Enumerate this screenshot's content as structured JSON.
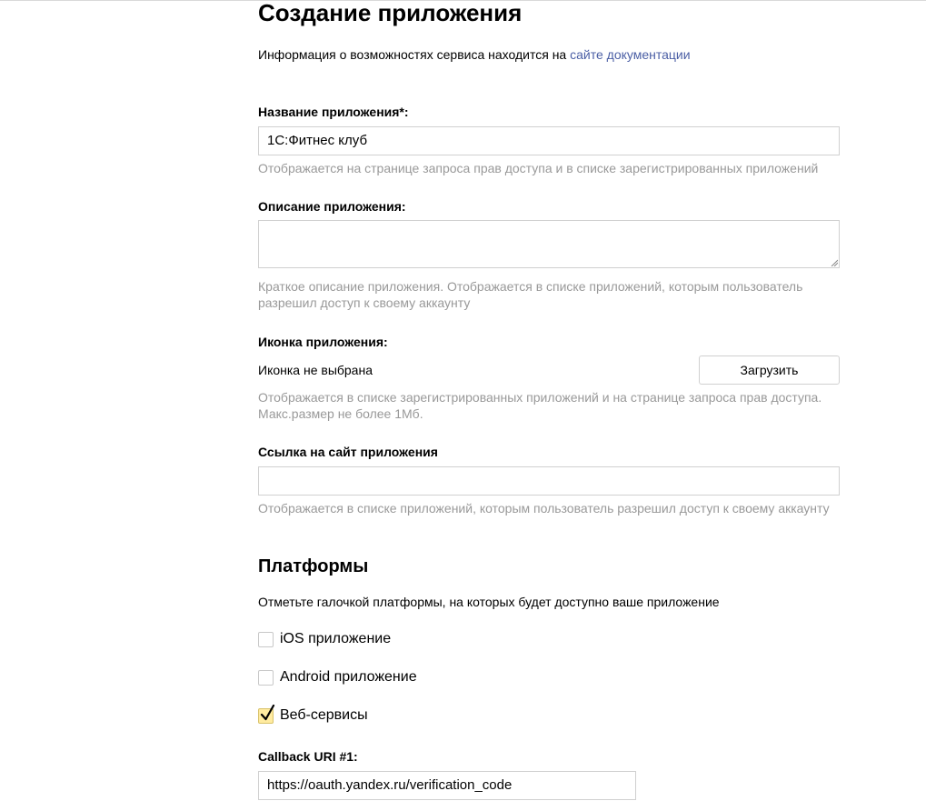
{
  "title": "Создание приложения",
  "intro": {
    "text": "Информация о возможностях сервиса находится на ",
    "link": "сайте документации"
  },
  "fields": {
    "name": {
      "label": "Название приложения",
      "required_mark": "*",
      "label_suffix": ":",
      "value": "1С:Фитнес клуб",
      "hint": "Отображается на странице запроса прав доступа и в списке зарегистрированных приложений"
    },
    "description": {
      "label": "Описание приложения:",
      "value": "",
      "hint": "Краткое описание приложения. Отображается в списке приложений, которым пользователь разрешил доступ к своему аккаунту"
    },
    "icon": {
      "label": "Иконка приложения:",
      "status": "Иконка не выбрана",
      "upload_label": "Загрузить",
      "hint": "Отображается в списке зарегистрированных приложений и на странице запроса прав доступа. Макс.размер не более 1Мб."
    },
    "site": {
      "label": "Ссылка на сайт приложения",
      "value": "",
      "hint": "Отображается в списке приложений, которым пользователь разрешил доступ к своему аккаунту"
    }
  },
  "platforms": {
    "title": "Платформы",
    "description": "Отметьте галочкой платформы, на которых будет доступно ваше приложение",
    "options": [
      {
        "label": "iOS приложение",
        "checked": false
      },
      {
        "label": "Android приложение",
        "checked": false
      },
      {
        "label": "Веб-сервисы",
        "checked": true
      }
    ]
  },
  "callback": {
    "label": "Callback URI #1:",
    "value": "https://oauth.yandex.ru/verification_code"
  },
  "colors": {
    "link": "#4b5fa5",
    "hint": "#999999",
    "border": "#d0d0d0",
    "checkbox_checked_bg": "#ffeba0"
  }
}
